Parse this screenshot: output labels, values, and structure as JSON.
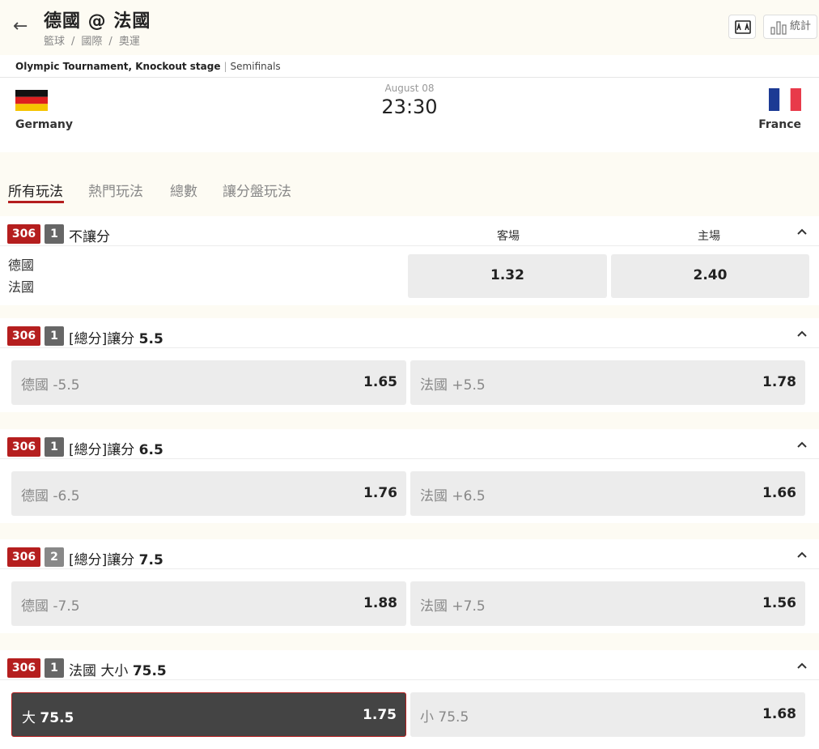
{
  "header": {
    "back_icon": "arrow-left-icon",
    "title": "德國 @ 法國",
    "breadcrumb": [
      "籃球",
      "國際",
      "奧運"
    ],
    "stats_label": "統計"
  },
  "competition": {
    "name": "Olympic Tournament, Knockout stage",
    "stage": "Semifinals"
  },
  "match": {
    "home": "Germany",
    "away": "France",
    "date": "August 08",
    "time": "23:30"
  },
  "tabs": [
    "所有玩法",
    "熱門玩法",
    "總數",
    "讓分盤玩法"
  ],
  "markets": {
    "m1": {
      "badge": "306",
      "count": "1",
      "title": "不讓分",
      "col_away": "客場",
      "col_home": "主場",
      "team1": "德國",
      "team2": "法國",
      "odd1": "1.32",
      "odd2": "2.40"
    },
    "m2": {
      "badge": "306",
      "count": "1",
      "title_pre": "[總分]讓分 ",
      "title_line": "5.5",
      "opt1_label": "德國 -5.5",
      "opt1_odd": "1.65",
      "opt2_label": "法國 +5.5",
      "opt2_odd": "1.78"
    },
    "m3": {
      "badge": "306",
      "count": "1",
      "title_pre": "[總分]讓分 ",
      "title_line": "6.5",
      "opt1_label": "德國 -6.5",
      "opt1_odd": "1.76",
      "opt2_label": "法國 +6.5",
      "opt2_odd": "1.66"
    },
    "m4": {
      "badge": "306",
      "count": "2",
      "title_pre": "[總分]讓分 ",
      "title_line": "7.5",
      "opt1_label": "德國 -7.5",
      "opt1_odd": "1.88",
      "opt2_label": "法國 +7.5",
      "opt2_odd": "1.56"
    },
    "m5": {
      "badge": "306",
      "count": "1",
      "title_pre": "法國 大小 ",
      "title_line": "75.5",
      "opt1_pre": "大 ",
      "opt1_line": "75.5",
      "opt1_odd": "1.75",
      "opt2_label": "小 75.5",
      "opt2_odd": "1.68"
    }
  },
  "colors": {
    "accent_red": "#b51e1e",
    "selected_bg": "#444444",
    "odd_bg": "#ececec"
  }
}
